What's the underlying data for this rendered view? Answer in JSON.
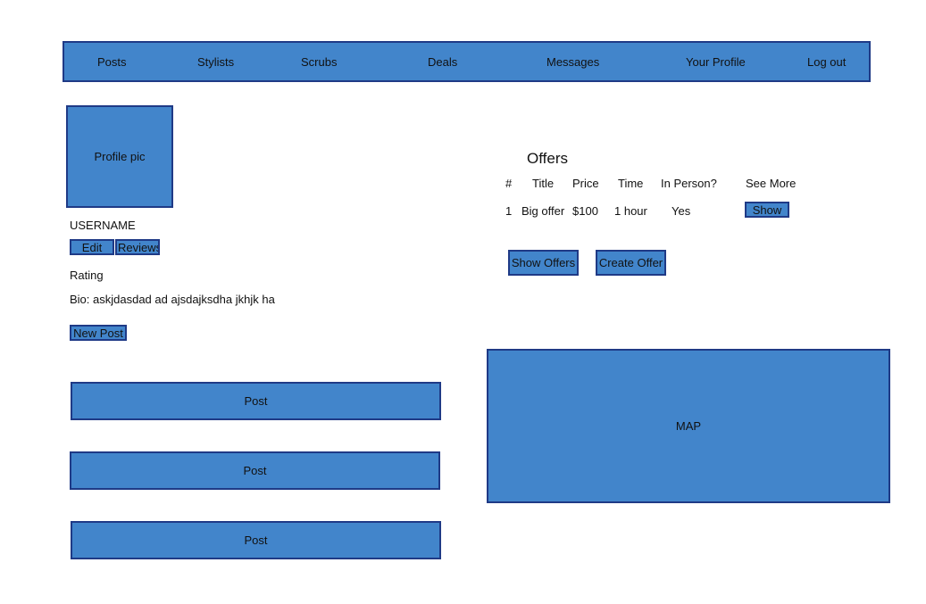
{
  "nav": {
    "items": [
      "Posts",
      "Stylists",
      "Scrubs",
      "Deals",
      "Messages",
      "Your Profile",
      "Log out"
    ]
  },
  "profile": {
    "pic_label": "Profile pic",
    "username": "USERNAME",
    "edit_label": "Edit",
    "reviews_label": "Reviews",
    "rating_label": "Rating",
    "bio": "Bio: askjdasdad ad ajsdajksdha jkhjk ha",
    "new_post_label": "New Post"
  },
  "posts": [
    "Post",
    "Post",
    "Post"
  ],
  "offers": {
    "title": "Offers",
    "headers": [
      "#",
      "Title",
      "Price",
      "Time",
      "In Person?",
      "See More"
    ],
    "rows": [
      {
        "num": "1",
        "title": "Big offer",
        "price": "$100",
        "time": "1 hour",
        "in_person": "Yes",
        "action": "Show"
      }
    ],
    "show_offers_label": "Show Offers",
    "create_offer_label": "Create Offer"
  },
  "map": {
    "label": "MAP"
  },
  "colors": {
    "fill": "#4285cb",
    "border": "#1f3a86"
  }
}
